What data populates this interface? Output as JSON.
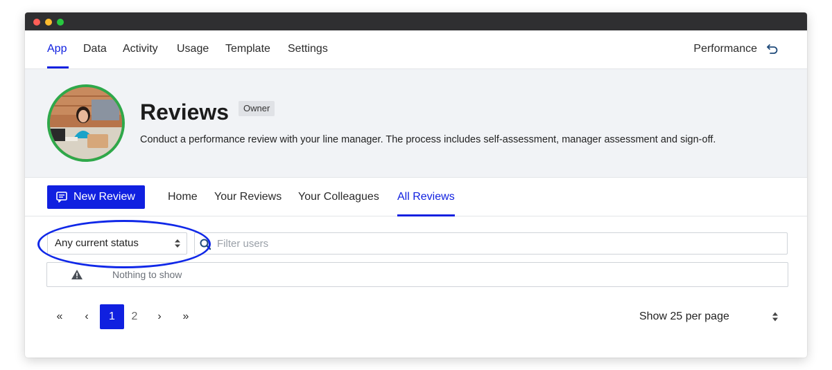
{
  "topnav": {
    "items": [
      "App",
      "Data",
      "Activity",
      "Usage",
      "Template",
      "Settings"
    ],
    "active": "App",
    "right_label": "Performance",
    "right_icon": "return-icon"
  },
  "header": {
    "title": "Reviews",
    "badge": "Owner",
    "description": "Conduct a performance review with your line manager. The process includes self-assessment, manager assessment and sign-off."
  },
  "subnav": {
    "new_button": "New Review",
    "tabs": [
      "Home",
      "Your Reviews",
      "Your Colleagues",
      "All Reviews"
    ],
    "active": "All Reviews"
  },
  "filters": {
    "status_value": "Any current status",
    "search_placeholder": "Filter users"
  },
  "list": {
    "empty_message": "Nothing to show"
  },
  "pagination": {
    "first": "«",
    "prev": "‹",
    "pages": [
      "1",
      "2"
    ],
    "current": "1",
    "next": "›",
    "last": "»",
    "per_page": "Show 25 per page"
  },
  "colors": {
    "accent": "#1020e0",
    "avatar_ring": "#2fa84a",
    "annotation": "#1028e8"
  }
}
